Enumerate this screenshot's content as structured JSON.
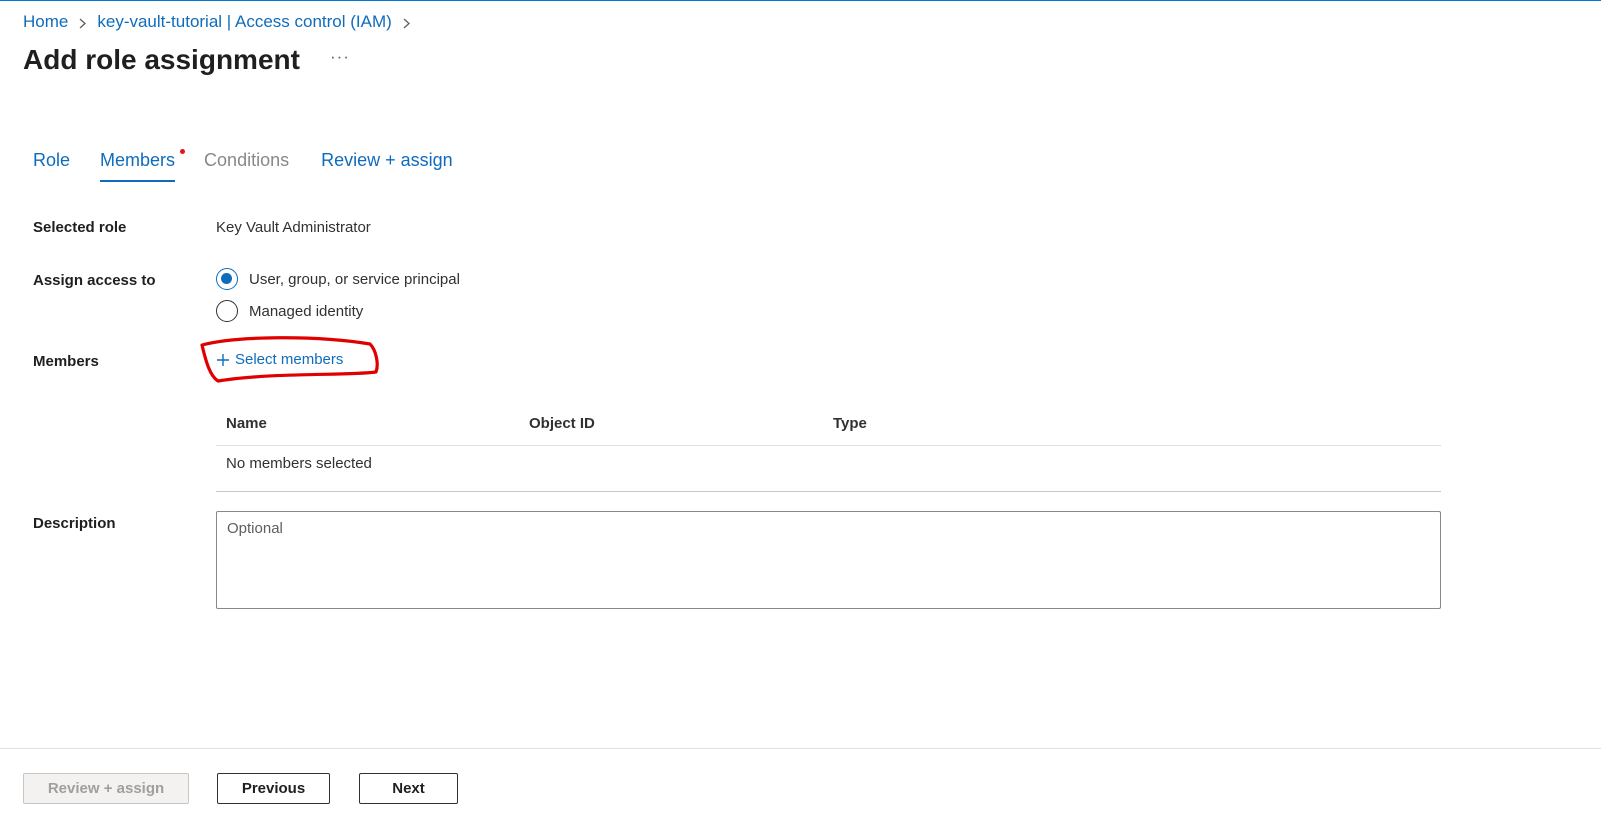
{
  "breadcrumb": {
    "home": "Home",
    "resource": "key-vault-tutorial | Access control (IAM)"
  },
  "page": {
    "title": "Add role assignment",
    "more": "···"
  },
  "tabs": [
    {
      "label": "Role",
      "state": "enabled"
    },
    {
      "label": "Members",
      "state": "active",
      "required_indicator": true
    },
    {
      "label": "Conditions",
      "state": "disabled"
    },
    {
      "label": "Review + assign",
      "state": "enabled"
    }
  ],
  "form": {
    "selected_role": {
      "label": "Selected role",
      "value": "Key Vault Administrator"
    },
    "assign_access_to": {
      "label": "Assign access to",
      "options": [
        {
          "label": "User, group, or service principal",
          "checked": true
        },
        {
          "label": "Managed identity",
          "checked": false
        }
      ]
    },
    "members": {
      "label": "Members",
      "select_link": "Select members",
      "table": {
        "columns": [
          "Name",
          "Object ID",
          "Type"
        ],
        "empty_text": "No members selected"
      }
    },
    "description": {
      "label": "Description",
      "placeholder": "Optional"
    }
  },
  "footer": {
    "review_assign": "Review + assign",
    "previous": "Previous",
    "next": "Next"
  },
  "colors": {
    "accent": "#0f6cbd",
    "annotation": "#e00000",
    "required_dot": "#e81123"
  }
}
